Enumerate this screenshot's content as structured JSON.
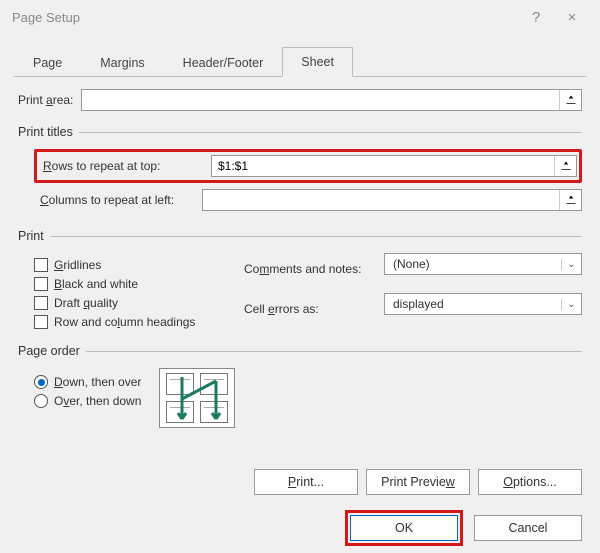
{
  "title": "Page Setup",
  "titlebar": {
    "help": "?",
    "close": "×"
  },
  "tabs": [
    "Page",
    "Margins",
    "Header/Footer",
    "Sheet"
  ],
  "active_tab": 3,
  "print_area": {
    "label": "Print area:",
    "value": ""
  },
  "print_titles_legend": "Print titles",
  "rows_repeat": {
    "label": "Rows to repeat at top:",
    "value": "$1:$1"
  },
  "cols_repeat": {
    "label": "Columns to repeat at left:",
    "value": ""
  },
  "print_legend": "Print",
  "checks": {
    "gridlines": "Gridlines",
    "bw": "Black and white",
    "draft": "Draft quality",
    "rowcol": "Row and column headings"
  },
  "comments": {
    "label": "Comments and notes:",
    "value": "(None)"
  },
  "cellerrors": {
    "label": "Cell errors as:",
    "value": "displayed"
  },
  "page_order_legend": "Page order",
  "order": {
    "down": "Down, then over",
    "over": "Over, then down",
    "selected": "down"
  },
  "buttons": {
    "print": "Print...",
    "preview": "Print Preview",
    "options": "Options..."
  },
  "footer": {
    "ok": "OK",
    "cancel": "Cancel"
  }
}
